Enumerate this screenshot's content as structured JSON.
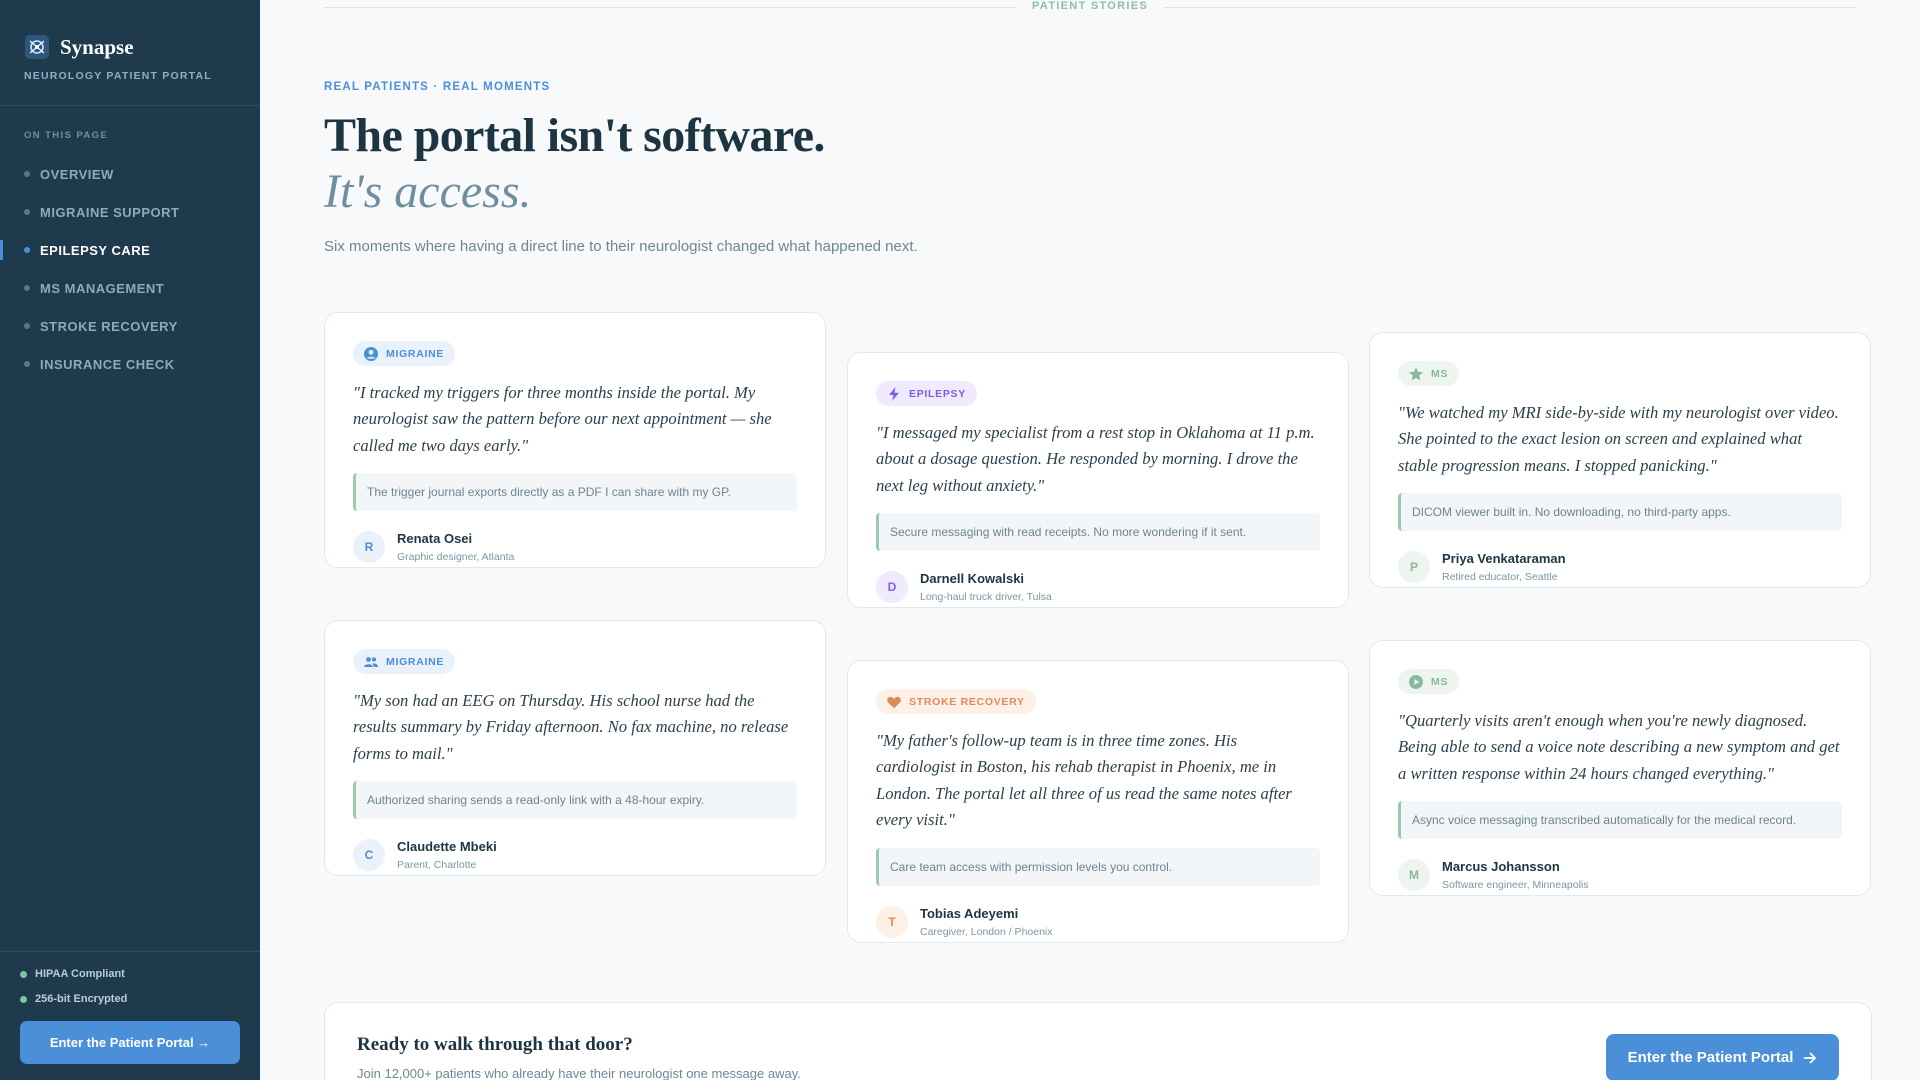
{
  "brand": {
    "name": "Synapse",
    "subtitle": "NEUROLOGY PATIENT PORTAL"
  },
  "nav": {
    "heading": "ON THIS PAGE",
    "items": [
      {
        "label": "OVERVIEW",
        "active": false
      },
      {
        "label": "MIGRAINE SUPPORT",
        "active": false
      },
      {
        "label": "EPILEPSY CARE",
        "active": true
      },
      {
        "label": "MS MANAGEMENT",
        "active": false
      },
      {
        "label": "STROKE RECOVERY",
        "active": false
      },
      {
        "label": "INSURANCE CHECK",
        "active": false
      }
    ]
  },
  "sidebar_footer": {
    "badges": [
      "HIPAA Compliant",
      "256-bit Encrypted"
    ],
    "cta_label": "Enter the Patient Portal →"
  },
  "section_label": "PATIENT STORIES",
  "hero": {
    "eyebrow": "REAL PATIENTS · REAL MOMENTS",
    "title": "The portal isn't software.",
    "title_italic": "It's access.",
    "lede": "Six moments where having a direct line to their neurologist changed what happened next."
  },
  "stories": [
    {
      "tag": "MIGRAINE",
      "tag_icon": "user-circle-icon",
      "color": "#4a8fd8",
      "quote": "\"I tracked my triggers for three months inside the portal. My neurologist saw the pattern before our next appointment — she called me two days early.\"",
      "note": "The trigger journal exports directly as a PDF I can share with my GP.",
      "initial": "R",
      "name": "Renata Osei",
      "role": "Graphic designer, Atlanta"
    },
    {
      "tag": "MIGRAINE",
      "tag_icon": "users-icon",
      "color": "#4a8fd8",
      "quote": "\"My son had an EEG on Thursday. His school nurse had the results summary by Friday afternoon. No fax machine, no release forms to mail.\"",
      "note": "Authorized sharing sends a read-only link with a 48-hour expiry.",
      "initial": "C",
      "name": "Claudette Mbeki",
      "role": "Parent, Charlotte"
    },
    {
      "tag": "EPILEPSY",
      "tag_icon": "lightning-icon",
      "color": "#7a5fe0",
      "quote": "\"I messaged my specialist from a rest stop in Oklahoma at 11 p.m. about a dosage question. He responded by morning. I drove the next leg without anxiety.\"",
      "note": "Secure messaging with read receipts. No more wondering if it sent.",
      "initial": "D",
      "name": "Darnell Kowalski",
      "role": "Long-haul truck driver, Tulsa"
    },
    {
      "tag": "STROKE RECOVERY",
      "tag_icon": "heart-icon",
      "color": "#e08a5a",
      "quote": "\"My father's follow-up team is in three time zones. His cardiologist in Boston, his rehab therapist in Phoenix, me in London. The portal let all three of us read the same notes after every visit.\"",
      "note": "Care team access with permission levels you control.",
      "initial": "T",
      "name": "Tobias Adeyemi",
      "role": "Caregiver, London / Phoenix"
    },
    {
      "tag": "MS",
      "tag_icon": "star-icon",
      "color": "#8ab89c",
      "quote": "\"We watched my MRI side-by-side with my neurologist over video. She pointed to the exact lesion on screen and explained what stable progression means. I stopped panicking.\"",
      "note": "DICOM viewer built in. No downloading, no third-party apps.",
      "initial": "P",
      "name": "Priya Venkataraman",
      "role": "Retired educator, Seattle"
    },
    {
      "tag": "MS",
      "tag_icon": "play-circle-icon",
      "color": "#8ab89c",
      "quote": "\"Quarterly visits aren't enough when you're newly diagnosed. Being able to send a voice note describing a new symptom and get a written response within 24 hours changed everything.\"",
      "note": "Async voice messaging transcribed automatically for the medical record.",
      "initial": "M",
      "name": "Marcus Johansson",
      "role": "Software engineer, Minneapolis"
    }
  ],
  "cta": {
    "title": "Ready to walk through that door?",
    "subtitle": "Join 12,000+ patients who already have their neurologist one message away.",
    "button_label": "Enter the Patient Portal"
  }
}
